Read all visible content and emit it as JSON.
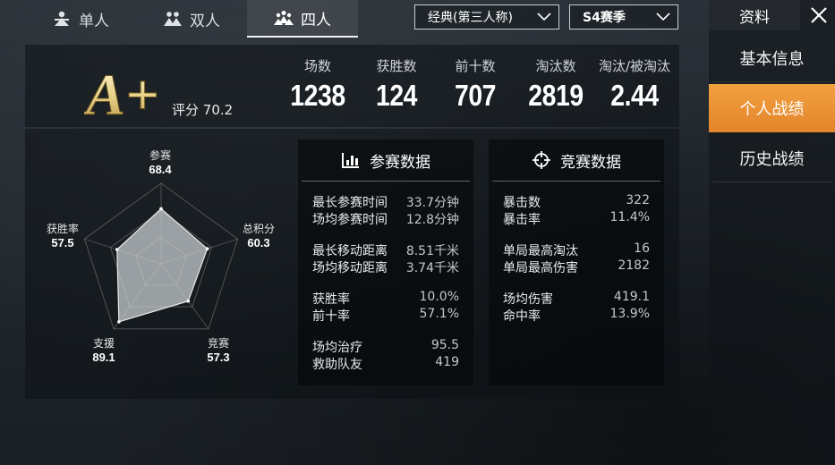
{
  "tabs": [
    {
      "label": "单人",
      "icon": "single-player-icon",
      "active": false
    },
    {
      "label": "双人",
      "icon": "duo-icon",
      "active": false
    },
    {
      "label": "四人",
      "icon": "squad-icon",
      "active": true
    }
  ],
  "mode_dropdown": {
    "value": "经典(第三人称)",
    "icon": "chevron-down-icon"
  },
  "season_dropdown": {
    "value": "S4赛季",
    "icon": "chevron-down-icon"
  },
  "sidebar": {
    "title": "资料",
    "close_icon": "close-icon",
    "items": [
      {
        "label": "基本信息",
        "active": false
      },
      {
        "label": "个人战绩",
        "active": true
      },
      {
        "label": "历史战绩",
        "active": false
      }
    ]
  },
  "colors": {
    "accent": "#e8902f",
    "panel": "#0c1014",
    "text": "#ffffff",
    "muted": "#c3c8cc",
    "grade_gold": "#e9d28b"
  },
  "summary": {
    "grade": "A+",
    "score_label": "评分",
    "score_value": "70.2",
    "stats": [
      {
        "label": "场数",
        "value": "1238"
      },
      {
        "label": "获胜数",
        "value": "124"
      },
      {
        "label": "前十数",
        "value": "707"
      },
      {
        "label": "淘汰数",
        "value": "2819"
      },
      {
        "label": "淘汰/被淘汰",
        "value": "2.44"
      }
    ]
  },
  "radar": {
    "axes": [
      {
        "label": "参赛",
        "value": "68.4"
      },
      {
        "label": "总积分",
        "value": "60.3"
      },
      {
        "label": "竞赛",
        "value": "57.3"
      },
      {
        "label": "支援",
        "value": "89.1"
      },
      {
        "label": "获胜率",
        "value": "57.5"
      }
    ],
    "max": 100
  },
  "participation": {
    "title": "参赛数据",
    "icon": "bar-chart-icon",
    "rows": [
      {
        "key": "最长参赛时间",
        "value": "33.7分钟"
      },
      {
        "key": "场均参赛时间",
        "value": "12.8分钟"
      },
      {
        "key": "最长移动距离",
        "value": "8.51千米"
      },
      {
        "key": "场均移动距离",
        "value": "3.74千米"
      },
      {
        "key": "获胜率",
        "value": "10.0%"
      },
      {
        "key": "前十率",
        "value": "57.1%"
      },
      {
        "key": "场均治疗",
        "value": "95.5"
      },
      {
        "key": "救助队友",
        "value": "419"
      }
    ]
  },
  "competition": {
    "title": "竞赛数据",
    "icon": "crosshair-icon",
    "rows": [
      {
        "key": "暴击数",
        "value": "322"
      },
      {
        "key": "暴击率",
        "value": "11.4%"
      },
      {
        "key": "单局最高淘汰",
        "value": "16"
      },
      {
        "key": "单局最高伤害",
        "value": "2182"
      },
      {
        "key": "场均伤害",
        "value": "419.1"
      },
      {
        "key": "命中率",
        "value": "13.9%"
      }
    ]
  }
}
